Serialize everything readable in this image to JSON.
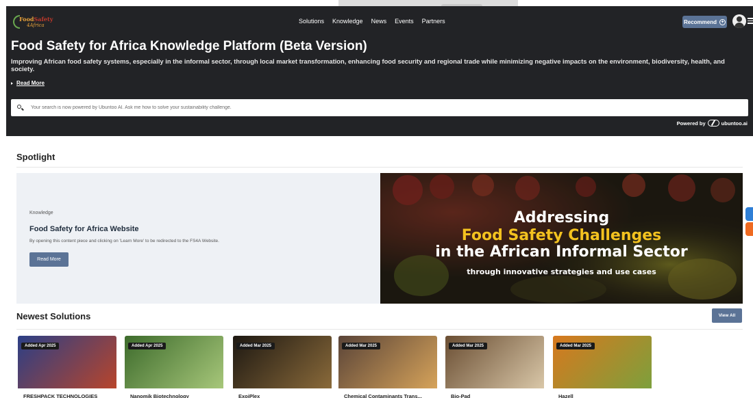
{
  "header": {
    "logo_name_a": "Food",
    "logo_name_b": "Safety",
    "logo_sub": "4Africa",
    "nav": [
      "Solutions",
      "Knowledge",
      "News",
      "Events",
      "Partners"
    ],
    "recommend_label": "Recommend"
  },
  "hero": {
    "title": "Food Safety for Africa Knowledge Platform (Beta Version)",
    "description": "Improving African food safety systems, especially in the informal sector, through local market transformation, enhancing food security and regional trade while minimizing negative impacts on the environment, biodiversity, health, and society.",
    "read_more": "Read More",
    "search_placeholder": "Your search is now powered by Ubuntoo AI. Ask me how to solve your sustainability challenge.",
    "powered_by": "Powered by",
    "powered_brand": "ubuntoo.ai"
  },
  "spotlight": {
    "heading": "Spotlight",
    "kicker": "Knowledge",
    "title": "Food Safety for Africa Website",
    "description": "By opening this content piece and clicking on 'Learn More' to be redirected to the FS4A Website.",
    "button": "Read More",
    "banner": {
      "line1": "Addressing",
      "line2": "Food Safety Challenges",
      "line3": "in the African Informal Sector",
      "line4": "through innovative strategies and use cases"
    }
  },
  "newest": {
    "heading": "Newest Solutions",
    "view_all": "View All",
    "cards": [
      {
        "badge": "Added Apr 2025",
        "title": "FRESHPACK TECHNOLOGIES",
        "c1": "#2b3f86",
        "c2": "#b8452b"
      },
      {
        "badge": "Added Apr 2025",
        "title": "Nanomik Biotechnology",
        "c1": "#3d6b2c",
        "c2": "#a7c77a"
      },
      {
        "badge": "Added Mar 2025",
        "title": "ExoiPlex",
        "c1": "#1d1812",
        "c2": "#8a6a3a"
      },
      {
        "badge": "Added Mar 2025",
        "title": "Chemical Contaminants Trans...",
        "c1": "#5a4438",
        "c2": "#d6a35a"
      },
      {
        "badge": "Added Mar 2025",
        "title": "Bio-Pad",
        "c1": "#6a4e33",
        "c2": "#d9c7a8"
      },
      {
        "badge": "Added Mar 2025",
        "title": "Hazell",
        "c1": "#d7781e",
        "c2": "#7da03c"
      }
    ]
  },
  "colors": {
    "hero_bg": "#222326",
    "accent_button": "#5b7396",
    "banner_highlight": "#f3c21f"
  }
}
